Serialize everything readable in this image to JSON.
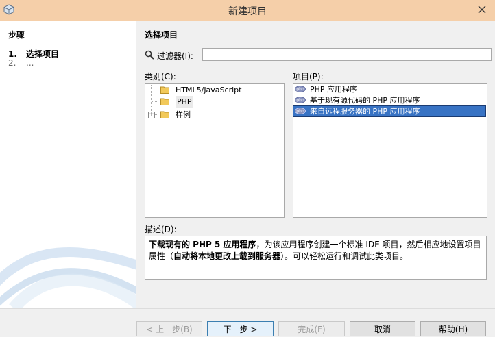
{
  "window": {
    "title": "新建项目"
  },
  "steps": {
    "heading": "步骤",
    "items": [
      {
        "num": "1.",
        "label": "选择项目"
      },
      {
        "num": "2.",
        "label": "..."
      }
    ]
  },
  "main": {
    "heading": "选择项目",
    "filter": {
      "label": "过滤器(I):",
      "value": ""
    },
    "categories": {
      "label": "类别(C):",
      "items": [
        "HTML5/JavaScript",
        "PHP",
        "样例"
      ],
      "selected": "PHP"
    },
    "projects": {
      "label": "项目(P):",
      "items": [
        "PHP 应用程序",
        "基于现有源代码的 PHP 应用程序",
        "来自远程服务器的 PHP 应用程序"
      ],
      "selected_index": 2
    },
    "description": {
      "label": "描述(D):",
      "parts": [
        "下载现有的 PHP 5 应用程序",
        "，为该应用程序创建一个标准 IDE 项目，然后相应地设置项目属性（",
        "自动将本地更改上载到服务器",
        "）。可以轻松运行和调试此类项目。"
      ]
    }
  },
  "buttons": {
    "back": "< 上一步(B)",
    "next": "下一步 >",
    "finish": "完成(F)",
    "cancel": "取消",
    "help": "帮助(H)"
  }
}
